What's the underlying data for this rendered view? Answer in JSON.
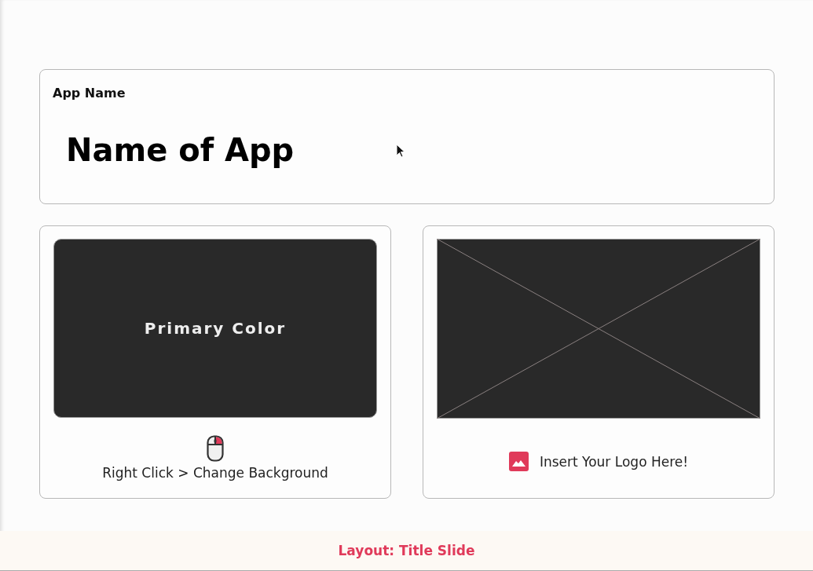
{
  "title_card": {
    "label": "App Name",
    "value": "Name of App"
  },
  "color_card": {
    "swatch_label": "Primary Color",
    "hint": "Right Click > Change Background"
  },
  "logo_card": {
    "hint": "Insert Your Logo Here!"
  },
  "footer": {
    "text": "Layout: Title Slide"
  }
}
